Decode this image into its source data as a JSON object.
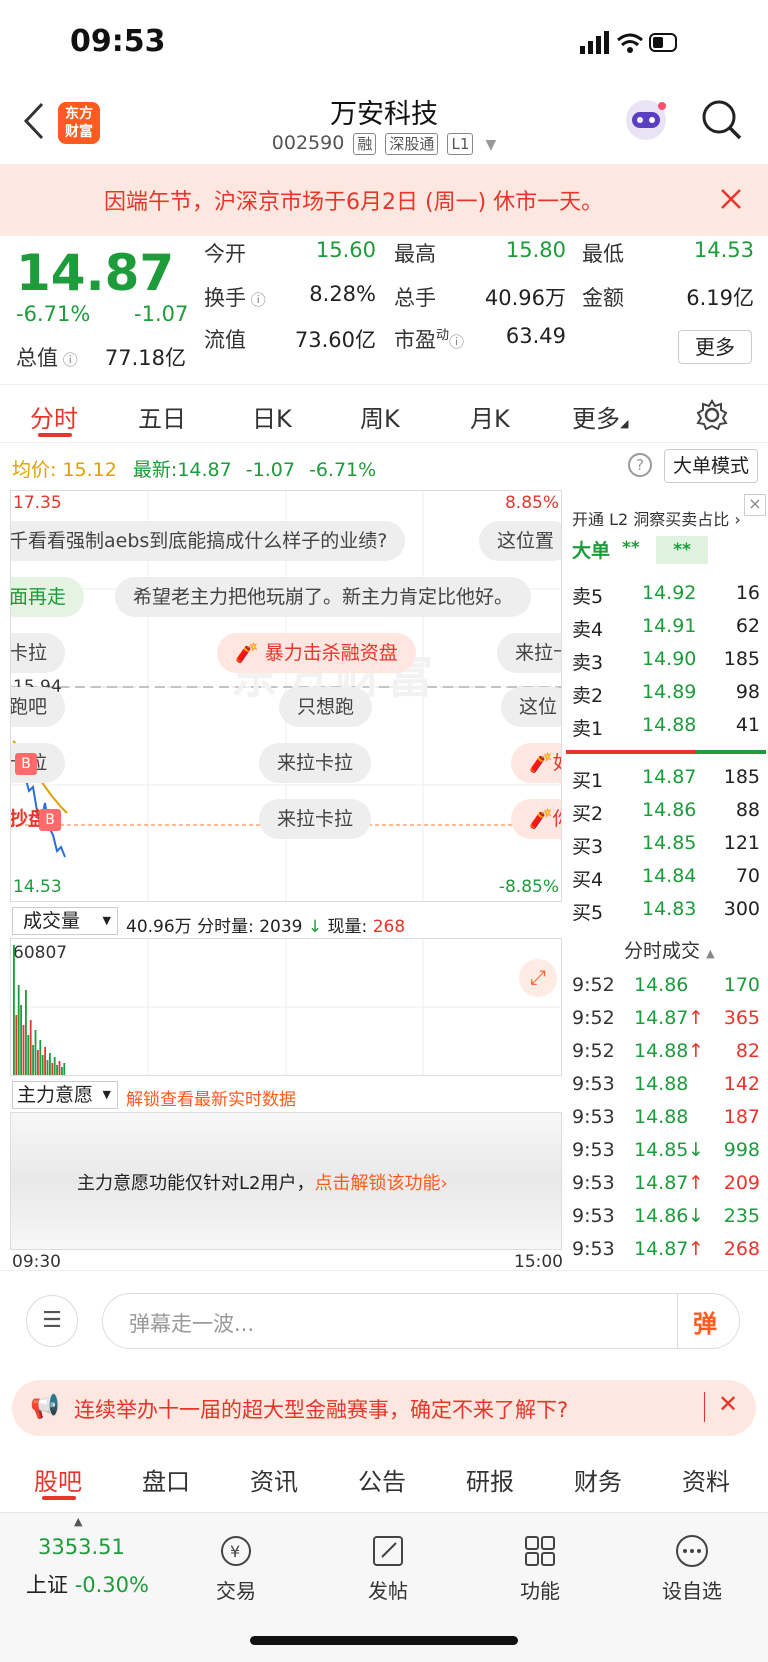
{
  "status": {
    "time": "09:53"
  },
  "header": {
    "logo_text": "东方财富",
    "title": "万安科技",
    "code": "002590",
    "tags": [
      "融",
      "深股通",
      "L1"
    ]
  },
  "notice": {
    "text": "因端午节，沪深京市场于6月2日 (周一) 休市一天。"
  },
  "quote": {
    "price": "14.87",
    "change_pct": "-6.71%",
    "change": "-1.07",
    "rows": [
      [
        {
          "label": "今开",
          "value": "15.60",
          "tone": "green"
        },
        {
          "label": "最高",
          "value": "15.80",
          "tone": "green"
        },
        {
          "label": "最低",
          "value": "14.53",
          "tone": "green"
        }
      ],
      [
        {
          "label": "换手",
          "value": "8.28%",
          "tone": "dark"
        },
        {
          "label": "总手",
          "value": "40.96万",
          "tone": "dark"
        },
        {
          "label": "金额",
          "value": "6.19亿",
          "tone": "dark"
        }
      ],
      [
        {
          "label": "流值",
          "value": "73.60亿",
          "tone": "dark"
        },
        {
          "label": "市盈",
          "value": "63.49",
          "tone": "dark"
        }
      ]
    ],
    "total_value_label": "总值",
    "total_value": "77.18亿",
    "pe_sup": "动",
    "more_button": "更多"
  },
  "tabs": [
    "分时",
    "五日",
    "日K",
    "周K",
    "月K",
    "更多"
  ],
  "infobar": {
    "avg_label": "均价:",
    "avg_value": "15.12",
    "latest_label": "最新:",
    "latest_value": "14.87",
    "latest_change": "-1.07",
    "latest_pct": "-6.71%",
    "mode_button": "大单模式"
  },
  "chart": {
    "top_price": "17.35",
    "top_pct": "8.85%",
    "mid_price": "15.94",
    "bottom_price": "14.53",
    "bottom_pct": "-8.85%",
    "watermark": "东方财富",
    "danmu": [
      "千看看强制aebs到底能搞成什么样子的业绩?",
      "这位置",
      "面再走",
      "希望老主力把他玩崩了。新主力肯定比他好。",
      "卡拉",
      "暴力击杀融资盘",
      "来拉卡",
      "跑吧",
      "只想跑",
      "这位",
      "卡拉",
      "来拉卡拉",
      "如",
      "抄盘?",
      "来拉卡拉",
      "你"
    ],
    "time_start": "09:30",
    "time_end": "15:00"
  },
  "orderbook": {
    "l2_promo": "开通 L2 洞察买卖占比",
    "big_order_label": "大单",
    "big_order_value": "**",
    "big_order_value2": "**",
    "asks": [
      {
        "label": "卖5",
        "price": "14.92",
        "vol": "16"
      },
      {
        "label": "卖4",
        "price": "14.91",
        "vol": "62"
      },
      {
        "label": "卖3",
        "price": "14.90",
        "vol": "185"
      },
      {
        "label": "卖2",
        "price": "14.89",
        "vol": "98"
      },
      {
        "label": "卖1",
        "price": "14.88",
        "vol": "41"
      }
    ],
    "bids": [
      {
        "label": "买1",
        "price": "14.87",
        "vol": "185"
      },
      {
        "label": "买2",
        "price": "14.86",
        "vol": "88"
      },
      {
        "label": "买3",
        "price": "14.85",
        "vol": "121"
      },
      {
        "label": "买4",
        "price": "14.84",
        "vol": "70"
      },
      {
        "label": "买5",
        "price": "14.83",
        "vol": "300"
      }
    ],
    "trades_title": "分时成交",
    "trades": [
      {
        "t": "9:52",
        "price": "14.86",
        "arrow": "",
        "vol": "170",
        "tone": "green"
      },
      {
        "t": "9:52",
        "price": "14.87",
        "arrow": "↑",
        "vol": "365",
        "tone": "red"
      },
      {
        "t": "9:52",
        "price": "14.88",
        "arrow": "↑",
        "vol": "82",
        "tone": "red"
      },
      {
        "t": "9:53",
        "price": "14.88",
        "arrow": "",
        "vol": "142",
        "tone": "red"
      },
      {
        "t": "9:53",
        "price": "14.88",
        "arrow": "",
        "vol": "187",
        "tone": "red"
      },
      {
        "t": "9:53",
        "price": "14.85",
        "arrow": "↓",
        "vol": "998",
        "tone": "green"
      },
      {
        "t": "9:53",
        "price": "14.87",
        "arrow": "↑",
        "vol": "209",
        "tone": "red"
      },
      {
        "t": "9:53",
        "price": "14.86",
        "arrow": "↓",
        "vol": "235",
        "tone": "green"
      },
      {
        "t": "9:53",
        "price": "14.87",
        "arrow": "↑",
        "vol": "268",
        "tone": "red"
      }
    ]
  },
  "volume": {
    "selector": "成交量",
    "total": "40.96万",
    "per_min_label": "分时量:",
    "per_min": "2039",
    "now_label": "现量:",
    "now": "268",
    "max": "60807"
  },
  "will": {
    "selector": "主力意愿",
    "unlock_link": "解锁查看最新实时数据",
    "message": "主力意愿功能仅针对L2用户，",
    "message_link": "点击解锁该功能"
  },
  "danmu_input": {
    "placeholder": "弹幕走一波...",
    "send_label": "弹"
  },
  "ad": {
    "text": "连续举办十一届的超大型金融赛事，确定不来了解下?"
  },
  "bottom_tabs": [
    "股吧",
    "盘口",
    "资讯",
    "公告",
    "研报",
    "财务",
    "资料"
  ],
  "bottom_nav": {
    "index_value": "3353.51",
    "index_name": "上证",
    "index_pct": "-0.30%",
    "items": [
      "交易",
      "发帖",
      "功能",
      "设自选"
    ]
  },
  "colors": {
    "up": "#e8352b",
    "down": "#1e9b3a",
    "accent": "#ff5a1f"
  }
}
